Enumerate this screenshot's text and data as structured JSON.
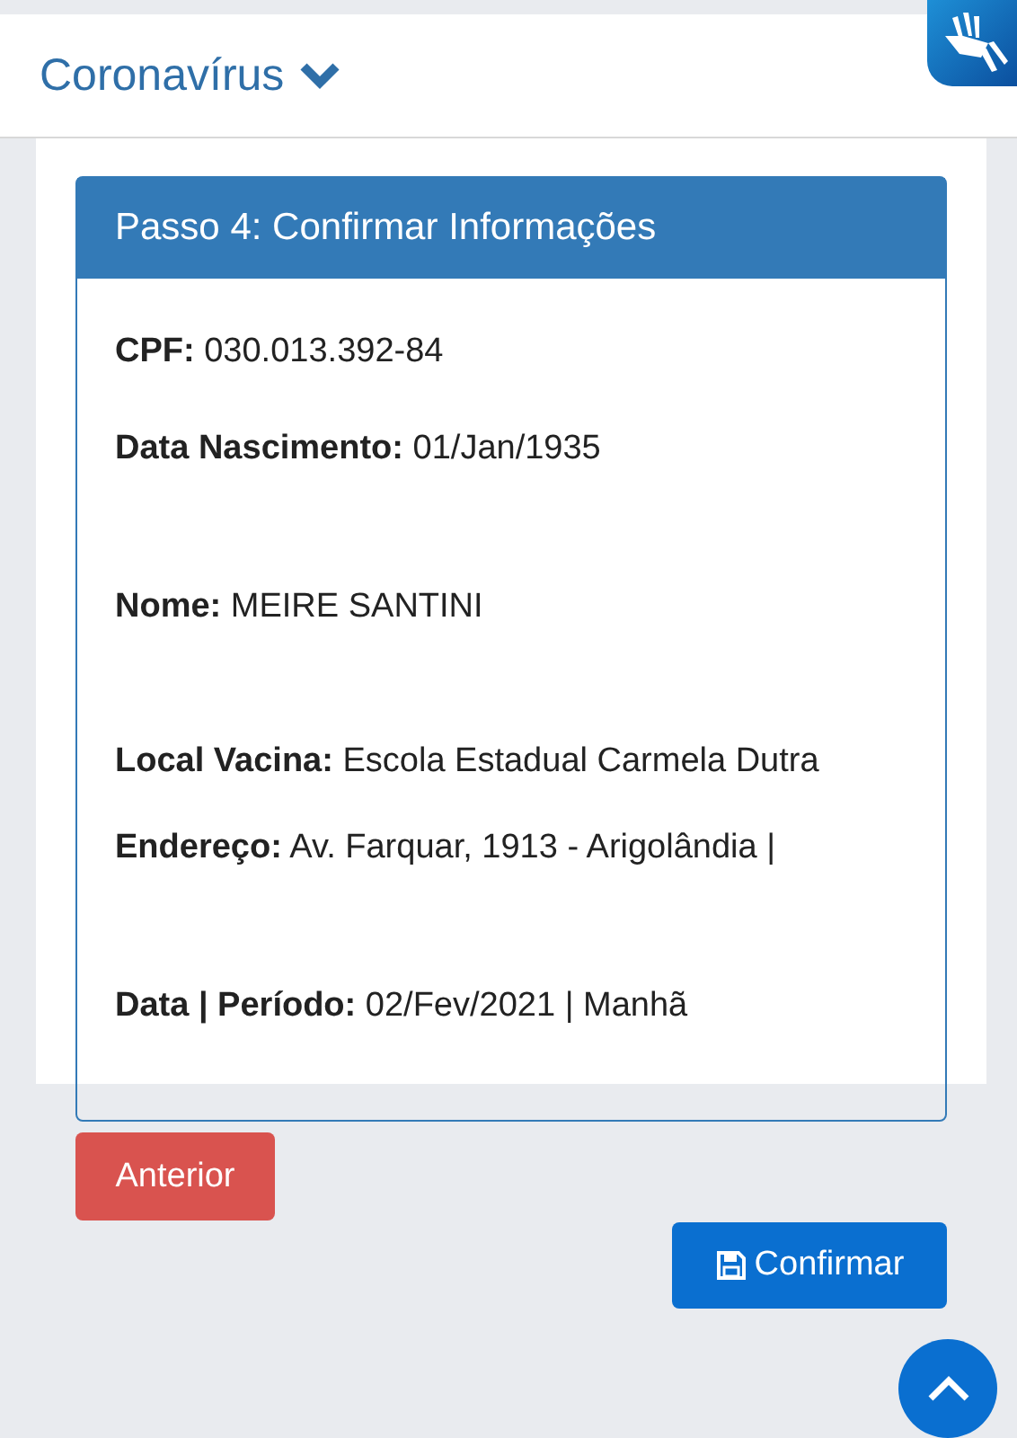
{
  "header": {
    "title": "Coronavírus"
  },
  "card": {
    "title": "Passo 4: Confirmar Informações",
    "fields": [
      {
        "text": "**CPF:** 030.013.392-84"
      },
      {
        "text": "**Data Nascimento:** 01/Jan/1935"
      },
      {
        "text": "**Nome:** MEIRE SANTINI"
      },
      {
        "text": "**Local Vacina:** Escola Estadual Carmela Dutra"
      },
      {
        "text": "**Endereço:** Av. Farquar, 1913 - Arigolândia |"
      },
      {
        "text": "**Data | Período:** 02/Fev/2021 | Manhã"
      }
    ]
  },
  "buttons": {
    "previous": "Anterior",
    "confirm": "Confirmar"
  }
}
